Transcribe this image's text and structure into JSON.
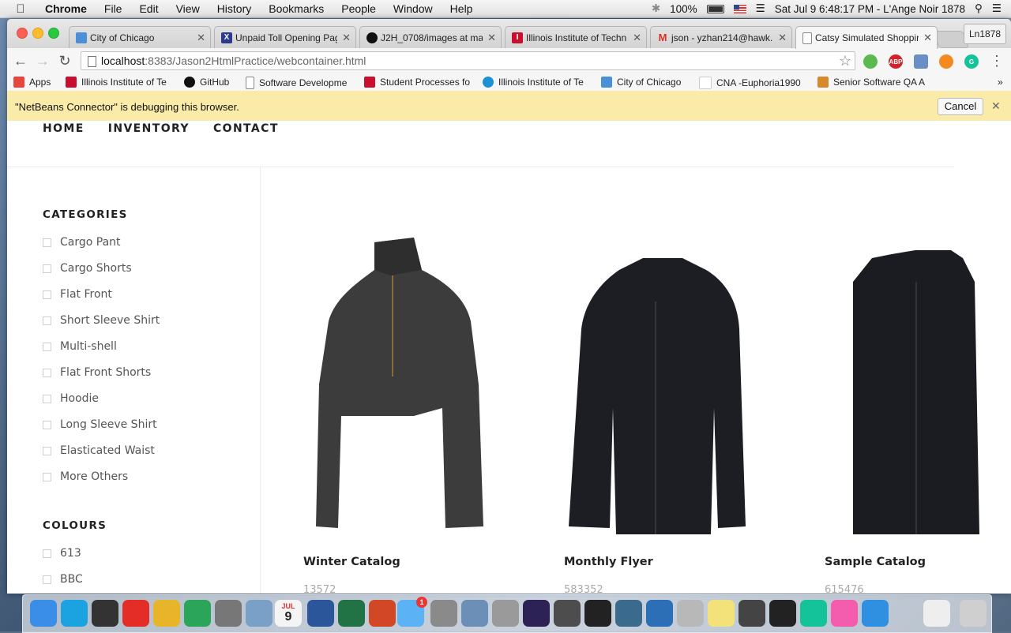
{
  "menubar": {
    "app": "Chrome",
    "items": [
      "File",
      "Edit",
      "View",
      "History",
      "Bookmarks",
      "People",
      "Window",
      "Help"
    ],
    "battery": "100%",
    "clock": "Sat Jul 9  6:48:17 PM - L'Ange Noir 1878"
  },
  "tabs": [
    {
      "label": "City of Chicago",
      "color": "#4a90d9"
    },
    {
      "label": "Unpaid Toll Opening Pag",
      "color": "#2b3a8c"
    },
    {
      "label": "J2H_0708/images at ma",
      "color": "#111111"
    },
    {
      "label": "Illinois Institute of Techn",
      "color": "#c8102e"
    },
    {
      "label": "json - yzhan214@hawk.",
      "color": "#d93025"
    },
    {
      "label": "Catsy Simulated Shoppir",
      "color": "#888888"
    }
  ],
  "profile_label": "Ln1878",
  "url": {
    "host": "localhost",
    "rest": ":8383/Jason2HtmlPractice/webcontainer.html"
  },
  "bookmarks": [
    {
      "label": "Apps",
      "color": "#e8453c"
    },
    {
      "label": "Illinois Institute of Te",
      "color": "#c8102e"
    },
    {
      "label": "GitHub",
      "color": "#111111"
    },
    {
      "label": "Software Developme",
      "color": "#bbbbbb"
    },
    {
      "label": "Student Processes fo",
      "color": "#c8102e"
    },
    {
      "label": "Illinois Institute of Te",
      "color": "#1e90d6"
    },
    {
      "label": "City of Chicago",
      "color": "#4a90d9"
    },
    {
      "label": "CNA -Euphoria1990",
      "color": "#dddddd"
    },
    {
      "label": "Senior Software QA A",
      "color": "#d88a2a"
    }
  ],
  "infobar": {
    "message": "\"NetBeans Connector\" is debugging this browser.",
    "cancel": "Cancel"
  },
  "nav": [
    "HOME",
    "INVENTORY",
    "CONTACT"
  ],
  "categories": {
    "heading": "CATEGORIES",
    "items": [
      "Cargo Pant",
      "Cargo Shorts",
      "Flat Front",
      "Short Sleeve Shirt",
      "Multi-shell",
      "Flat Front Shorts",
      "Hoodie",
      "Long Sleeve Shirt",
      "Elasticated Waist",
      "More Others"
    ]
  },
  "colours": {
    "heading": "COLOURS",
    "items": [
      "613",
      "BBC"
    ]
  },
  "products": [
    {
      "title": "Winter Catalog",
      "sku": "13572",
      "garment": "quarter-zip pullover",
      "color": "#3c3c3c"
    },
    {
      "title": "Monthly Flyer",
      "sku": "583352",
      "garment": "full-zip jacket",
      "color": "#1c1e24"
    },
    {
      "title": "Sample Catalog",
      "sku": "615476",
      "garment": "vest",
      "color": "#1a1c22"
    }
  ],
  "dock": [
    {
      "name": "finder-icon",
      "color": "#3b8ee8"
    },
    {
      "name": "skype-icon",
      "color": "#1aa3e0"
    },
    {
      "name": "dashboard-icon",
      "color": "#333333"
    },
    {
      "name": "youtube-icon",
      "color": "#e52d27"
    },
    {
      "name": "chrome-icon",
      "color": "#e8b52a"
    },
    {
      "name": "google-drive-icon",
      "color": "#2aa55a"
    },
    {
      "name": "calculator-icon",
      "color": "#777777"
    },
    {
      "name": "preview-icon",
      "color": "#7aa0c8"
    },
    {
      "name": "calendar-icon",
      "color": "#f4f4f4"
    },
    {
      "name": "word-icon",
      "color": "#2b579a"
    },
    {
      "name": "excel-icon",
      "color": "#217346"
    },
    {
      "name": "powerpoint-icon",
      "color": "#d24726"
    },
    {
      "name": "messages-icon",
      "color": "#5bb2f5"
    },
    {
      "name": "system-preferences-icon",
      "color": "#8a8a8a"
    },
    {
      "name": "virtualbox-icon",
      "color": "#6c8fb8"
    },
    {
      "name": "database-icon",
      "color": "#9a9a9a"
    },
    {
      "name": "eclipse-icon",
      "color": "#2c2255"
    },
    {
      "name": "sublime-icon",
      "color": "#4d4d4d"
    },
    {
      "name": "terminal-icon",
      "color": "#222222"
    },
    {
      "name": "mysql-workbench-icon",
      "color": "#3a6b8c"
    },
    {
      "name": "quicktime-icon",
      "color": "#2d6fb7"
    },
    {
      "name": "network-utility-icon",
      "color": "#b8b8b8"
    },
    {
      "name": "stickies-icon",
      "color": "#f3e27a"
    },
    {
      "name": "printer-icon",
      "color": "#444444"
    },
    {
      "name": "qq-icon",
      "color": "#222222"
    },
    {
      "name": "grammarly-icon",
      "color": "#15c39a"
    },
    {
      "name": "itunes-icon",
      "color": "#f45cae"
    },
    {
      "name": "safari-icon",
      "color": "#2f8fe0"
    },
    {
      "name": "document-stack-icon",
      "color": "#eeeeee"
    },
    {
      "name": "trash-icon",
      "color": "#cfcfcf"
    }
  ],
  "dock_badges": {
    "messages": "1",
    "calendar_month": "JUL",
    "calendar_day": "9"
  }
}
